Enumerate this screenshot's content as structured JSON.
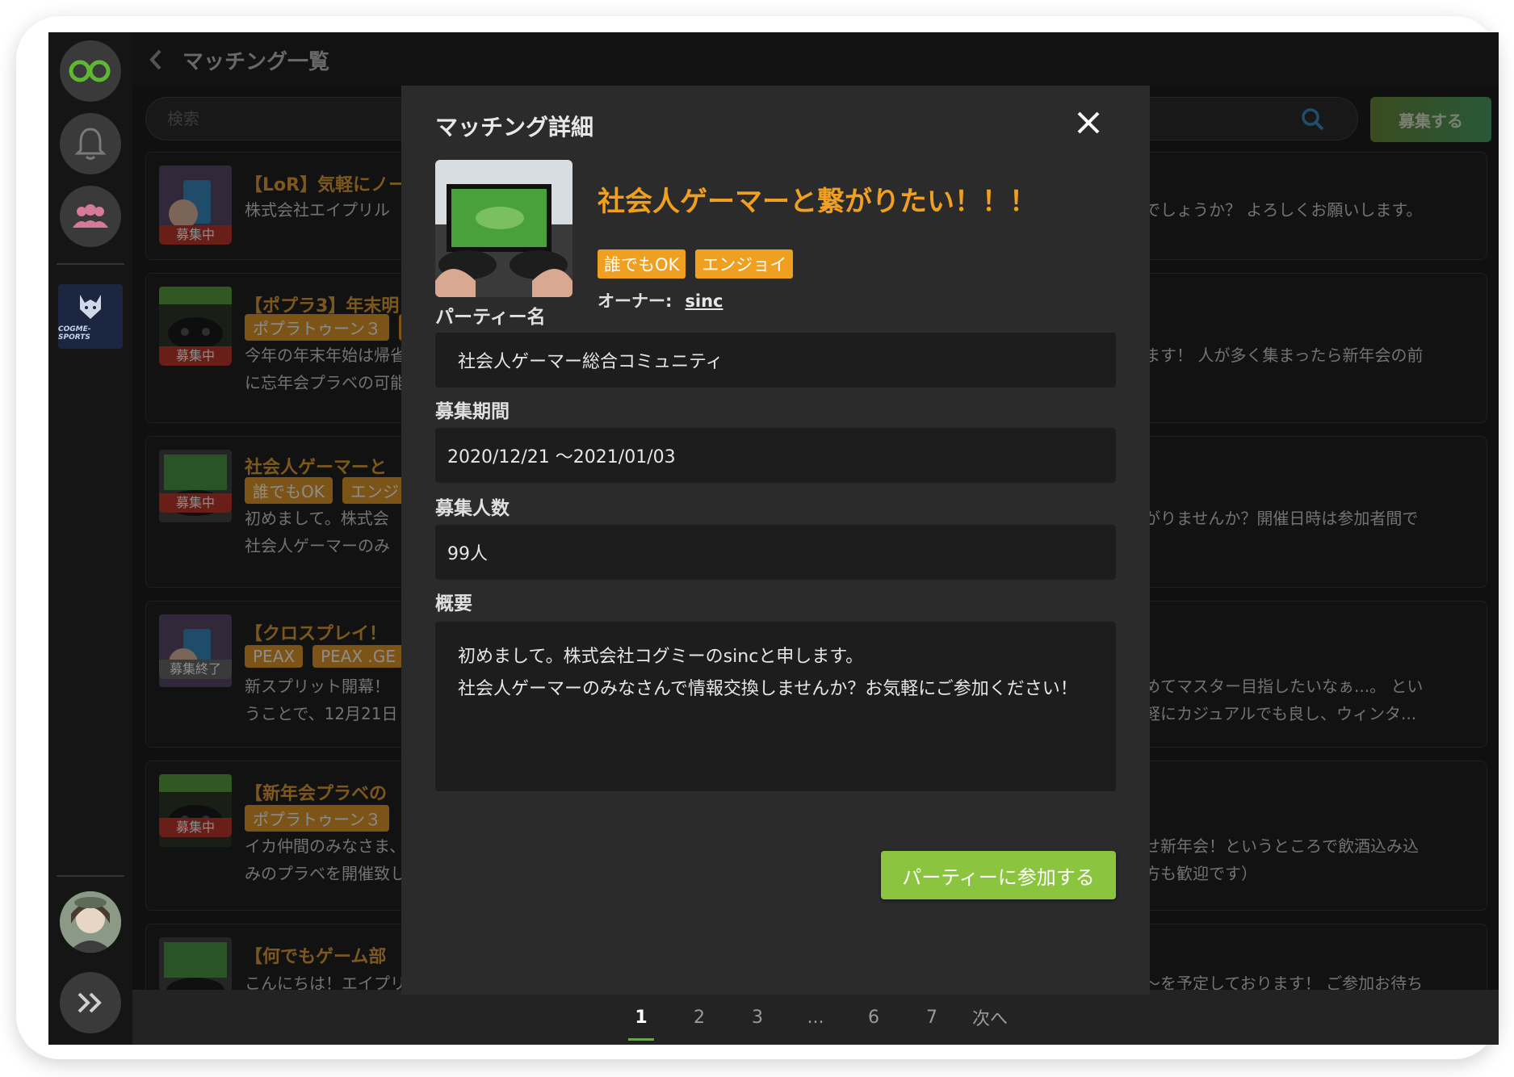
{
  "header": {
    "title": "マッチング一覧"
  },
  "search": {
    "placeholder": "検索"
  },
  "recruit_button": "募集する",
  "sidebar": {
    "logo_text": "COGME-SPORTS"
  },
  "cards": [
    {
      "title": "【LoR】気軽にノー",
      "tags": [],
      "desc": [
        "株式会社エイプリル"
      ],
      "right": [
        "でしょうか？ よろしくお願いします。"
      ],
      "status": "募集中"
    },
    {
      "title": "【ポプラ3】年末明",
      "tags": [
        "ポプラトゥーン３",
        " "
      ],
      "desc": [
        "今年の年末年始は帰省",
        "に忘年会プラベの可能"
      ],
      "right": [
        "ます！ 人が多く集まったら新年会の前"
      ],
      "status": "募集中"
    },
    {
      "title": "社会人ゲーマーと",
      "tags": [
        "誰でもOK",
        "エンジ"
      ],
      "desc": [
        "初めまして。株式会",
        "社会人ゲーマーのみ"
      ],
      "right": [
        "がりませんか？開催日時は参加者間で"
      ],
      "status": "募集中"
    },
    {
      "title": "【クロスプレイ！",
      "tags": [
        "PEAX",
        "PEAX .GE"
      ],
      "desc": [
        "新スプリット開幕！",
        "うことで、12月21日"
      ],
      "right": [
        "めてマスター目指したいなぁ...。 とい",
        "軽にカジュアルでも良し、ウィンタ..."
      ],
      "status": "募集終了"
    },
    {
      "title": "【新年会プラベの",
      "tags": [
        "ポプラトゥーン３"
      ],
      "desc": [
        "イカ仲間のみなさま、",
        "みのプラベを開催致し"
      ],
      "right": [
        "せ新年会！というところで飲酒込み込",
        "方も歓迎です）"
      ],
      "status": "募集中"
    },
    {
      "title": "【何でもゲーム部",
      "tags": [],
      "desc": [
        "こんにちは！エイプリ"
      ],
      "right": [
        "〜を予定しております！ ご参加お待ち"
      ],
      "status": ""
    }
  ],
  "pagination": {
    "pages": [
      "1",
      "2",
      "3",
      "...",
      "6",
      "7"
    ],
    "next": "次へ",
    "current": "1"
  },
  "modal": {
    "title": "マッチング詳細",
    "party_display_name": "社会人ゲーマーと繋がりたい！！！",
    "tags": [
      "誰でもOK",
      "エンジョイ"
    ],
    "owner_label": "オーナー:",
    "owner_name": "sinc",
    "fields": {
      "party_name_label": "パーティー名",
      "party_name_value": "社会人ゲーマー総合コミュニティ",
      "period_label": "募集期間",
      "period_value": "2020/12/21 〜2021/01/03",
      "count_label": "募集人数",
      "count_value": "99人",
      "summary_label": "概要",
      "summary_value": "初めまして。株式会社コグミーのsincと申します。\n社会人ゲーマーのみなさんで情報交換しませんか？お気軽にご参加ください！"
    },
    "join_button": "パーティーに参加する"
  },
  "colors": {
    "accent_orange": "#f0a020",
    "join_green": "#8bc53f",
    "status_red": "#c0392b"
  }
}
